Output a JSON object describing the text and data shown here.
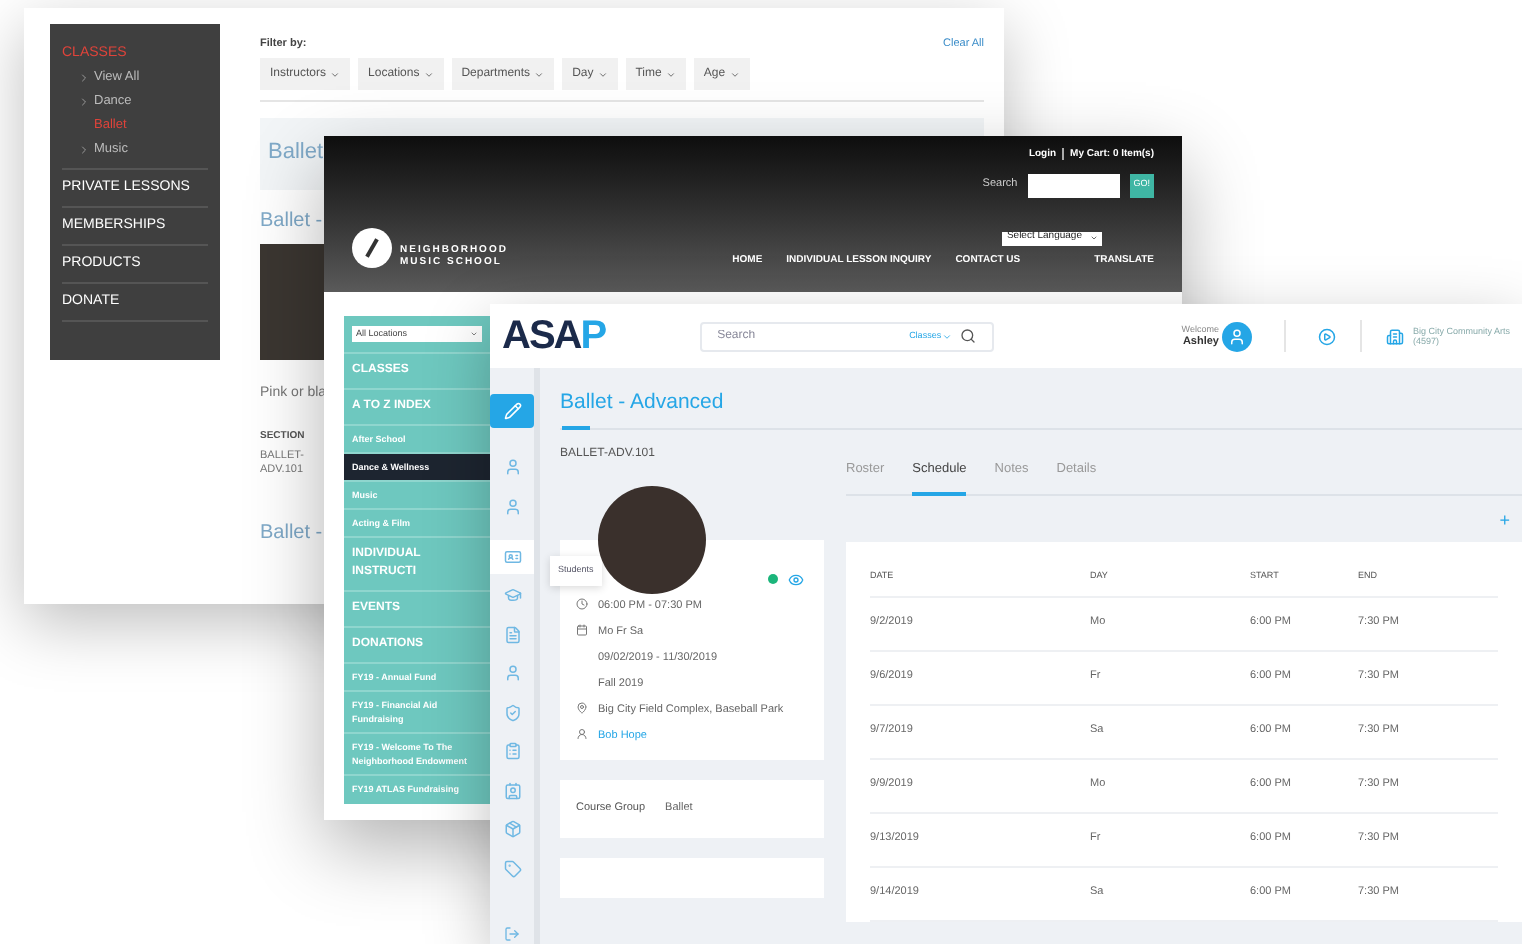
{
  "catalog_window": {
    "sidebar": [
      {
        "label": "CLASSES",
        "selected": true,
        "children": [
          {
            "label": "View All",
            "selected": false
          },
          {
            "label": "Dance",
            "selected": false,
            "children": [
              {
                "label": "Ballet",
                "selected": true
              }
            ]
          },
          {
            "label": "Music",
            "selected": false
          }
        ]
      },
      {
        "label": "PRIVATE LESSONS",
        "selected": false
      },
      {
        "label": "MEMBERSHIPS",
        "selected": false
      },
      {
        "label": "PRODUCTS",
        "selected": false
      },
      {
        "label": "DONATE",
        "selected": false
      }
    ],
    "filter_label": "Filter by:",
    "clear_all": "Clear All",
    "filters": [
      "Instructors",
      "Locations",
      "Departments",
      "Day",
      "Time",
      "Age"
    ],
    "group_title": "Ballet",
    "class_title": "Ballet -",
    "description": "Pink or bla",
    "section_header": "SECTION",
    "section_value": "BALLET-ADV.101",
    "next_class_title": "Ballet -"
  },
  "school_window": {
    "account_links": [
      "Login",
      "My Cart: 0 Item(s)"
    ],
    "search_label": "Search",
    "go_button": "GO!",
    "logo_text": [
      "NEIGHBORHOOD",
      "MUSIC SCHOOL"
    ],
    "language_select": "Select Language",
    "nav": [
      "HOME",
      "INDIVIDUAL LESSON INQUIRY",
      "CONTACT US"
    ],
    "translate": "TRANSLATE",
    "location_select": "All Locations",
    "menu": [
      {
        "label": "CLASSES",
        "kind": "heading",
        "selected": false
      },
      {
        "label": "A TO Z INDEX",
        "kind": "heading",
        "selected": false
      },
      {
        "label": "After School",
        "kind": "sub",
        "selected": false
      },
      {
        "label": "Dance & Wellness",
        "kind": "sub",
        "selected": true
      },
      {
        "label": "Music",
        "kind": "sub",
        "selected": false
      },
      {
        "label": "Acting & Film",
        "kind": "sub",
        "selected": false
      },
      {
        "label": "INDIVIDUAL INSTRUCTI",
        "kind": "heading",
        "selected": false
      },
      {
        "label": "EVENTS",
        "kind": "heading",
        "selected": false
      },
      {
        "label": "DONATIONS",
        "kind": "heading",
        "selected": false
      },
      {
        "label": "FY19 - Annual Fund",
        "kind": "sub",
        "selected": false
      },
      {
        "label": "FY19 - Financial Aid Fundraising",
        "kind": "sub",
        "selected": false
      },
      {
        "label": "FY19 - Welcome To The Neighborhood Endowment",
        "kind": "sub",
        "selected": false
      },
      {
        "label": "FY19 ATLAS Fundraising",
        "kind": "sub",
        "selected": false
      }
    ]
  },
  "admin_window": {
    "logo": [
      "ASA",
      "P"
    ],
    "search_placeholder": "Search",
    "search_scope": "Classes",
    "welcome": "Welcome",
    "user": "Ashley",
    "org": [
      "Big City Community Arts",
      "(4597)"
    ],
    "rail": [
      {
        "selected": true,
        "hovered": false
      },
      {
        "selected": false,
        "hovered": false
      },
      {
        "selected": false,
        "hovered": false
      },
      {
        "selected": false,
        "hovered": true
      },
      {
        "selected": false,
        "hovered": false
      },
      {
        "selected": false,
        "hovered": false
      },
      {
        "selected": false,
        "hovered": false
      },
      {
        "selected": false,
        "hovered": false
      },
      {
        "selected": false,
        "hovered": false
      },
      {
        "selected": false,
        "hovered": false
      },
      {
        "selected": false,
        "hovered": false
      },
      {
        "selected": false,
        "hovered": false
      }
    ],
    "tooltip": "Students",
    "title": "Ballet - Advanced",
    "code": "BALLET-ADV.101",
    "status_active": true,
    "details": [
      {
        "kind": "clock",
        "text": "06:00 PM - 07:30 PM"
      },
      {
        "kind": "calendar",
        "text": "Mo Fr Sa"
      },
      {
        "kind": "plain",
        "text": "09/02/2019 - 11/30/2019"
      },
      {
        "kind": "plain",
        "text": "Fall 2019"
      },
      {
        "kind": "location",
        "text": "Big City Field Complex, Baseball Park"
      },
      {
        "kind": "person",
        "text": "Bob Hope"
      }
    ],
    "course_group_label": "Course Group",
    "course_group": "Ballet",
    "tabs": [
      {
        "label": "Roster",
        "selected": false
      },
      {
        "label": "Schedule",
        "selected": true
      },
      {
        "label": "Notes",
        "selected": false
      },
      {
        "label": "Details",
        "selected": false
      }
    ],
    "add_button": "+",
    "table": {
      "columns": [
        "DATE",
        "DAY",
        "START",
        "END"
      ],
      "rows": [
        [
          "9/2/2019",
          "Mo",
          "6:00 PM",
          "7:30 PM"
        ],
        [
          "9/6/2019",
          "Fr",
          "6:00 PM",
          "7:30 PM"
        ],
        [
          "9/7/2019",
          "Sa",
          "6:00 PM",
          "7:30 PM"
        ],
        [
          "9/9/2019",
          "Mo",
          "6:00 PM",
          "7:30 PM"
        ],
        [
          "9/13/2019",
          "Fr",
          "6:00 PM",
          "7:30 PM"
        ],
        [
          "9/14/2019",
          "Sa",
          "6:00 PM",
          "7:30 PM"
        ]
      ]
    }
  }
}
